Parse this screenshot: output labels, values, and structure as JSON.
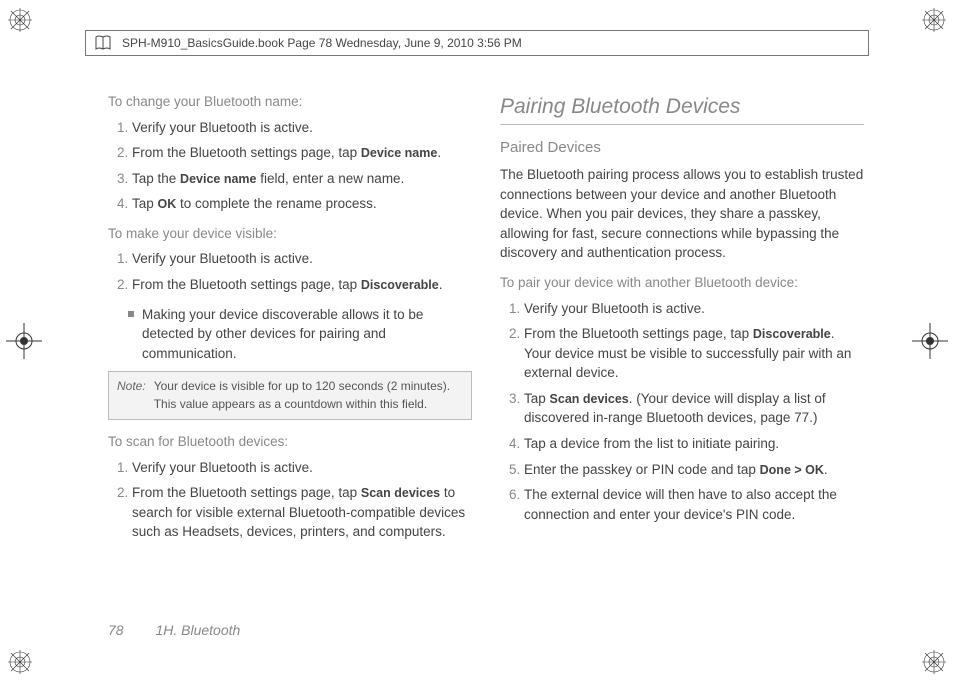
{
  "header": {
    "text": "SPH-M910_BasicsGuide.book  Page 78  Wednesday, June 9, 2010  3:56 PM"
  },
  "left": {
    "lead1": "To change your Bluetooth name:",
    "steps1": [
      {
        "pre": "Verify your Bluetooth is active."
      },
      {
        "pre": "From the Bluetooth settings page, tap ",
        "ui": "Device name",
        "post": "."
      },
      {
        "pre": "Tap the ",
        "ui": "Device name",
        "post": " field, enter a new name."
      },
      {
        "pre": "Tap ",
        "ui": "OK",
        "post": " to complete the rename process."
      }
    ],
    "lead2": "To make your device visible:",
    "steps2": [
      {
        "pre": "Verify your Bluetooth is active."
      },
      {
        "pre": "From the Bluetooth settings page, tap ",
        "ui": "Discoverable",
        "post": "."
      }
    ],
    "sub_bullet": "Making your device discoverable allows it to be detected by other devices for pairing and communication.",
    "note_label": "Note:",
    "note_text": "Your device is visible for up to 120 seconds (2 minutes). This value appears as a countdown within this field.",
    "lead3": "To scan for Bluetooth devices:",
    "steps3": [
      {
        "pre": "Verify your Bluetooth is active."
      },
      {
        "pre": "From the Bluetooth settings page, tap ",
        "ui": "Scan devices",
        "post": " to search for visible external Bluetooth-compatible devices such as Headsets, devices, printers, and computers."
      }
    ]
  },
  "right": {
    "section_title": "Pairing Bluetooth Devices",
    "subsection": "Paired Devices",
    "intro": "The Bluetooth pairing process allows you to establish trusted connections between your device and another Bluetooth device. When you pair devices, they share a passkey, allowing for fast, secure connections while bypassing the discovery and authentication process.",
    "lead": "To pair your device with another Bluetooth device:",
    "steps": [
      {
        "pre": "Verify your Bluetooth is active."
      },
      {
        "pre": "From the Bluetooth settings page, tap ",
        "ui": "Discoverable",
        "post": ". Your device must be visible to successfully pair with an external device."
      },
      {
        "pre": "Tap ",
        "ui": "Scan devices",
        "post": ". (Your device will display a list of discovered in-range Bluetooth devices, page 77.)"
      },
      {
        "pre": "Tap a device from the list to initiate pairing."
      },
      {
        "pre": "Enter the passkey or PIN code and tap ",
        "ui": "Done > OK",
        "post": "."
      },
      {
        "pre": "The external device will then have to also accept the connection and enter your device's PIN code."
      }
    ]
  },
  "footer": {
    "page_number": "78",
    "section": "1H. Bluetooth"
  }
}
